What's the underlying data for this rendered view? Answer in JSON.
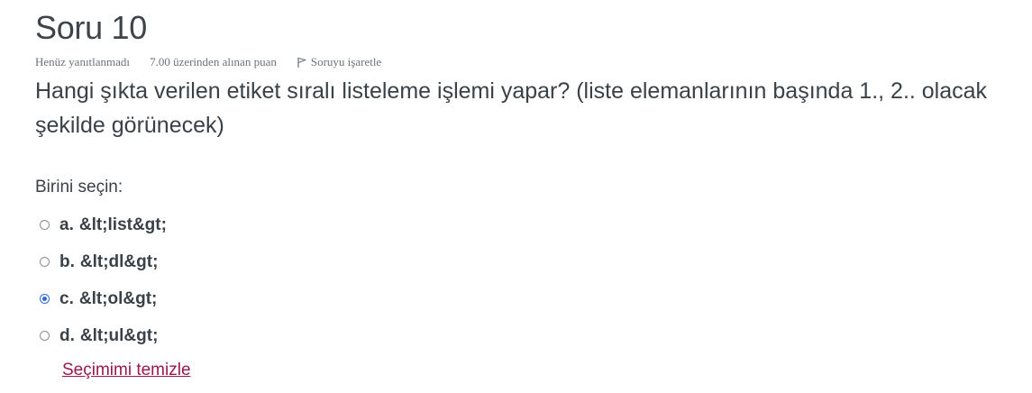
{
  "question": {
    "title": "Soru 10",
    "state": "Henüz yanıtlanmadı",
    "grade": "7.00 üzerinden alınan puan",
    "flag_label": "Soruyu işaretle",
    "text": "Hangi şıkta verilen etiket sıralı listeleme işlemi yapar? (liste elemanlarının başında 1., 2.. olacak şekilde görünecek)",
    "prompt": "Birini seçin:",
    "options": [
      {
        "letter": "a.",
        "text": "&lt;list&gt;",
        "selected": false
      },
      {
        "letter": "b.",
        "text": "&lt;dl&gt;",
        "selected": false
      },
      {
        "letter": "c.",
        "text": "&lt;ol&gt;",
        "selected": true
      },
      {
        "letter": "d.",
        "text": "&lt;ul&gt;",
        "selected": false
      }
    ],
    "clear_label": "Seçimimi temizle"
  },
  "colors": {
    "link": "#9a1750",
    "radio_checked": "#2f6bd8"
  }
}
